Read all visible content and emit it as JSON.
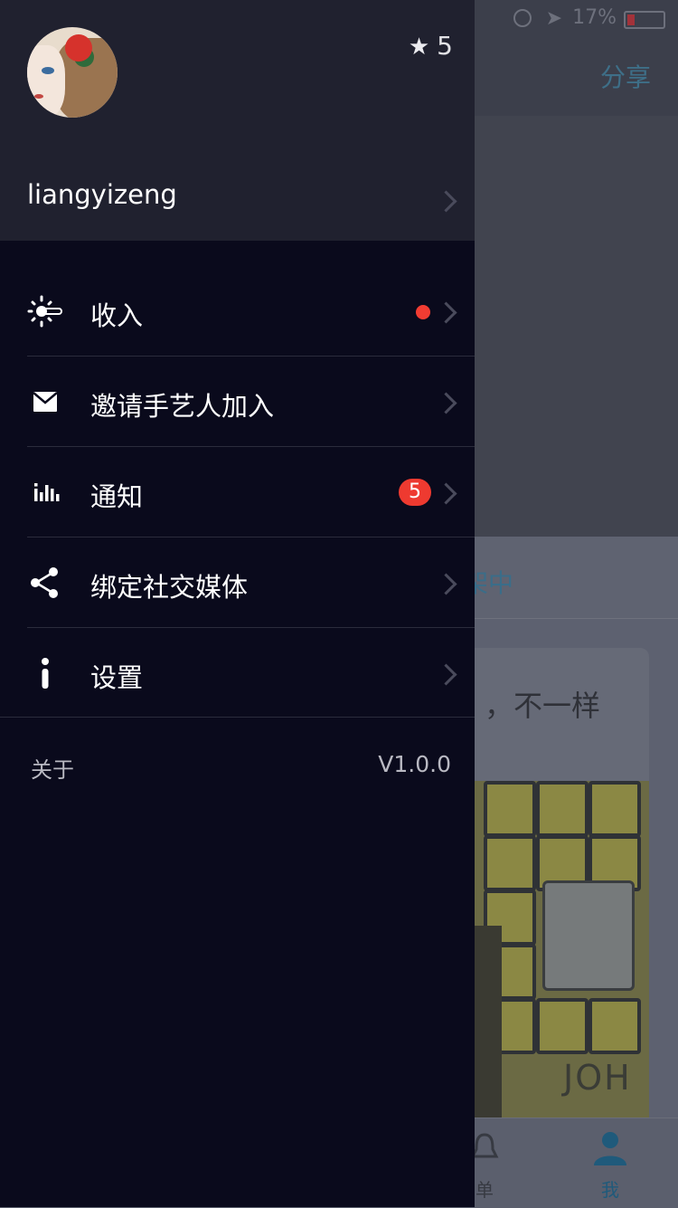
{
  "background": {
    "status_bar": {
      "battery_percent": "17%"
    },
    "nav": {
      "share_label": "分享"
    },
    "tab_label": "架中",
    "card_text": "，不一样",
    "photo_brand": "JOH",
    "bottom_tabs": [
      {
        "label": "单",
        "icon": "bell-icon"
      },
      {
        "label": "我",
        "icon": "person-icon"
      }
    ]
  },
  "drawer": {
    "profile": {
      "username": "liangyizeng",
      "star_count": "5"
    },
    "menu": [
      {
        "label": "收入",
        "icon": "sun-toggle-icon",
        "indicator": "dot"
      },
      {
        "label": "邀请手艺人加入",
        "icon": "envelope-icon"
      },
      {
        "label": "通知",
        "icon": "bar-chart-icon",
        "badge": "5"
      },
      {
        "label": "绑定社交媒体",
        "icon": "share-icon"
      },
      {
        "label": "设置",
        "icon": "info-icon"
      }
    ],
    "footer": {
      "about_label": "关于",
      "version": "V1.0.0"
    }
  },
  "colors": {
    "drawer_bg": "#0a0a1c",
    "profile_bg": "#20212f",
    "badge_red": "#ee3a30",
    "accent_blue": "#3a6d89"
  }
}
